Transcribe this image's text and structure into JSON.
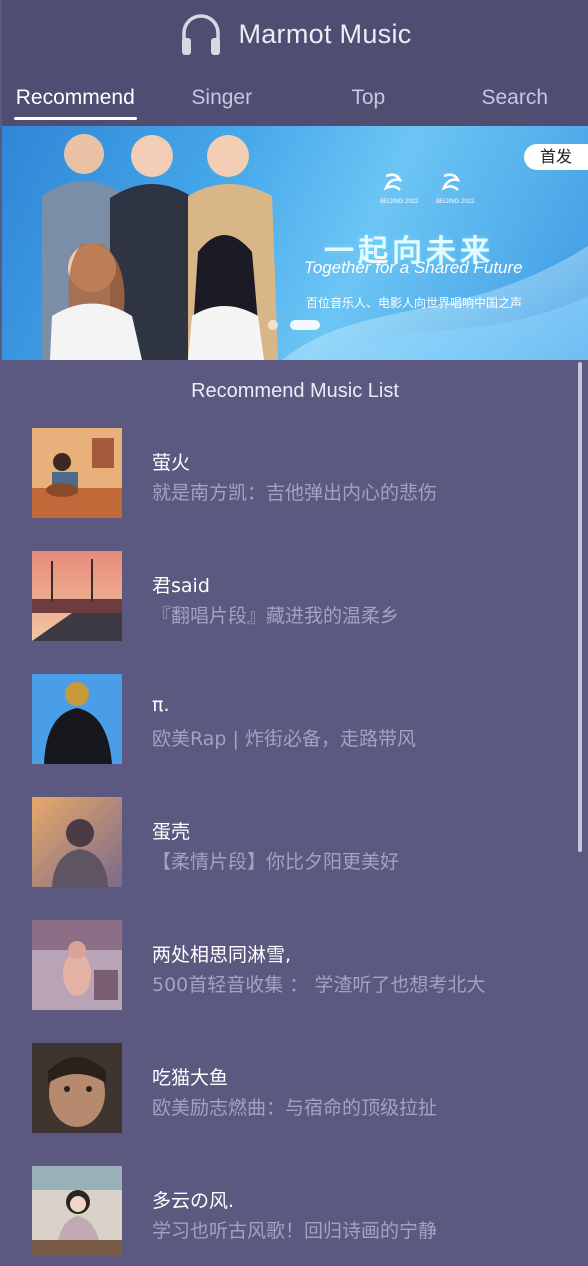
{
  "app": {
    "title": "Marmot Music",
    "logo_icon": "headphones-icon"
  },
  "tabs": [
    {
      "label": "Recommend",
      "active": true
    },
    {
      "label": "Singer",
      "active": false
    },
    {
      "label": "Top",
      "active": false
    },
    {
      "label": "Search",
      "active": false
    }
  ],
  "banner": {
    "badge": "首发",
    "headline": "一起向未来",
    "headline_en": "Together for a Shared Future",
    "subtitle": "百位音乐人、电影人向世界唱响中国之声",
    "logo_text": [
      "BEIJING 2022",
      "BEIJING 2022"
    ],
    "slide_count": 2,
    "active_slide": 1
  },
  "recommend": {
    "section_title": "Recommend Music List",
    "items": [
      {
        "title": "萤火",
        "desc": "就是南方凯：吉他弹出内心的悲伤"
      },
      {
        "title": "君said",
        "desc": "『翻唱片段』藏进我的温柔乡"
      },
      {
        "title": "π.",
        "desc": "欧美Rap | 炸街必备，走路带风"
      },
      {
        "title": "蛋壳",
        "desc": "【柔情片段】你比夕阳更美好"
      },
      {
        "title": "两处相思同淋雪,",
        "desc": "500首轻音收集 ： 学渣听了也想考北大"
      },
      {
        "title": "吃猫大鱼",
        "desc": "欧美励志燃曲：与宿命的顶级拉扯"
      },
      {
        "title": "多云の风.",
        "desc": "学习也听古风歌！回归诗画的宁静"
      }
    ]
  },
  "colors": {
    "background": "#5b597f",
    "header": "#4f4d72",
    "muted_text": "#a3a2c0",
    "banner_blue": "#46a7ea"
  }
}
